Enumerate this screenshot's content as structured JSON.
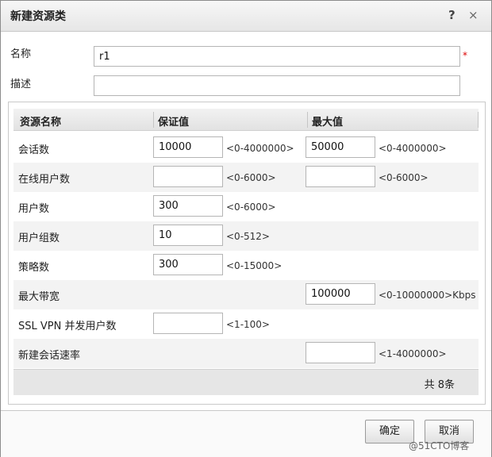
{
  "dialog": {
    "title": "新建资源类",
    "help_glyph": "?",
    "close_glyph": "×"
  },
  "form": {
    "name_label": "名称",
    "name_value": "r1",
    "required_mark": "*",
    "description_label": "描述",
    "description_value": ""
  },
  "grid": {
    "columns": [
      "资源名称",
      "保证值",
      "最大值"
    ],
    "rows": [
      {
        "name": "会话数",
        "guarantee": "10000",
        "guarantee_range": "<0-4000000>",
        "max": "50000",
        "max_range": "<0-4000000>"
      },
      {
        "name": "在线用户数",
        "guarantee": "",
        "guarantee_range": "<0-6000>",
        "max": "",
        "max_range": "<0-6000>"
      },
      {
        "name": "用户数",
        "guarantee": "300",
        "guarantee_range": "<0-6000>"
      },
      {
        "name": "用户组数",
        "guarantee": "10",
        "guarantee_range": "<0-512>"
      },
      {
        "name": "策略数",
        "guarantee": "300",
        "guarantee_range": "<0-15000>"
      },
      {
        "name": "最大带宽",
        "max": "100000",
        "max_range": "<0-10000000>Kbps"
      },
      {
        "name": "SSL VPN 并发用户数",
        "guarantee": "",
        "guarantee_range": "<1-100>"
      },
      {
        "name": "新建会话速率",
        "max": "",
        "max_range": "<1-4000000>"
      }
    ],
    "footer_total": "共 8条"
  },
  "buttons": {
    "ok": "确定",
    "cancel": "取消"
  },
  "watermark": "@51CTO博客"
}
